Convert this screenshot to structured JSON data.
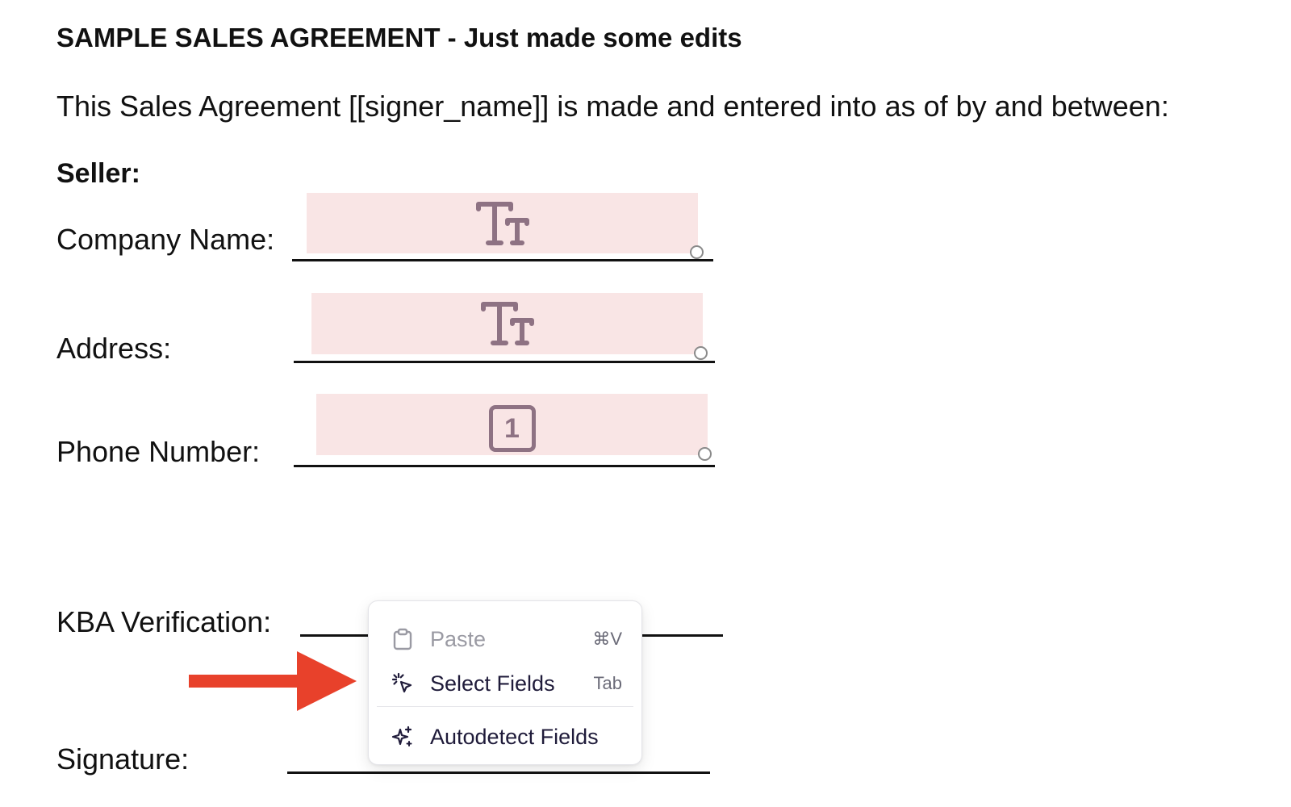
{
  "document": {
    "title": "SAMPLE SALES AGREEMENT - Just made some edits",
    "intro": "This Sales Agreement [[signer_name]]  is made and entered into as of by and between:",
    "seller_heading": "Seller:",
    "labels": {
      "company_name": "Company Name:",
      "address": "Address:",
      "phone_number": "Phone Number:",
      "kba_verification": "KBA Verification:",
      "signature": "Signature:"
    },
    "fields": {
      "company_name": {
        "type": "text",
        "icon": "text-type-icon"
      },
      "address": {
        "type": "text",
        "icon": "text-type-icon"
      },
      "phone_number": {
        "type": "number",
        "icon": "number-box-icon",
        "glyph": "1"
      }
    }
  },
  "context_menu": {
    "items": [
      {
        "label": "Paste",
        "shortcut": "⌘V",
        "icon": "clipboard-icon",
        "disabled": true
      },
      {
        "label": "Select Fields",
        "shortcut": "Tab",
        "icon": "cursor-click-icon",
        "disabled": false
      },
      {
        "label": "Autodetect Fields",
        "shortcut": "",
        "icon": "sparkles-icon",
        "disabled": false
      }
    ]
  },
  "annotation": {
    "arrow_color": "#e8412b",
    "icon": "arrow-right-icon"
  },
  "colors": {
    "field_fill": "#f9e5e5",
    "field_icon": "#8e7283",
    "menu_text": "#1f1b3a"
  }
}
